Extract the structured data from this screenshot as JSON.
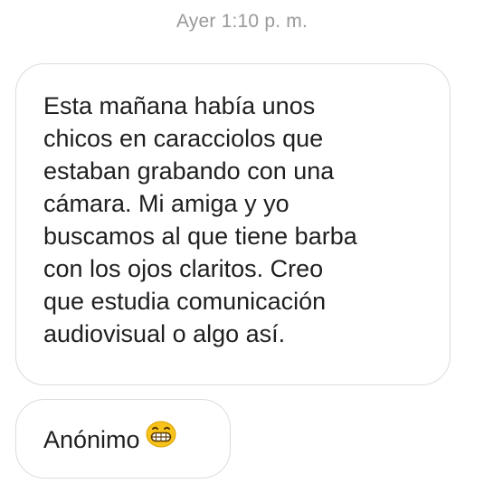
{
  "timestamp": "Ayer 1:10 p. m.",
  "messages": [
    {
      "lines": [
        "Esta mañana había unos",
        "chicos en caracciolos que",
        "estaban grabando con una",
        "cámara. Mi amiga y yo",
        "buscamos al que tiene barba",
        "con los ojos claritos. Creo",
        "que estudia comunicación",
        "audiovisual o algo así."
      ]
    },
    {
      "text": "Anónimo",
      "emoji": "grinning-face-emoji"
    }
  ],
  "colors": {
    "timestamp": "#9a9a9a",
    "bubble_border": "#dcdcdc",
    "text": "#1f1f1f",
    "emoji_face": "#f7c21a"
  }
}
